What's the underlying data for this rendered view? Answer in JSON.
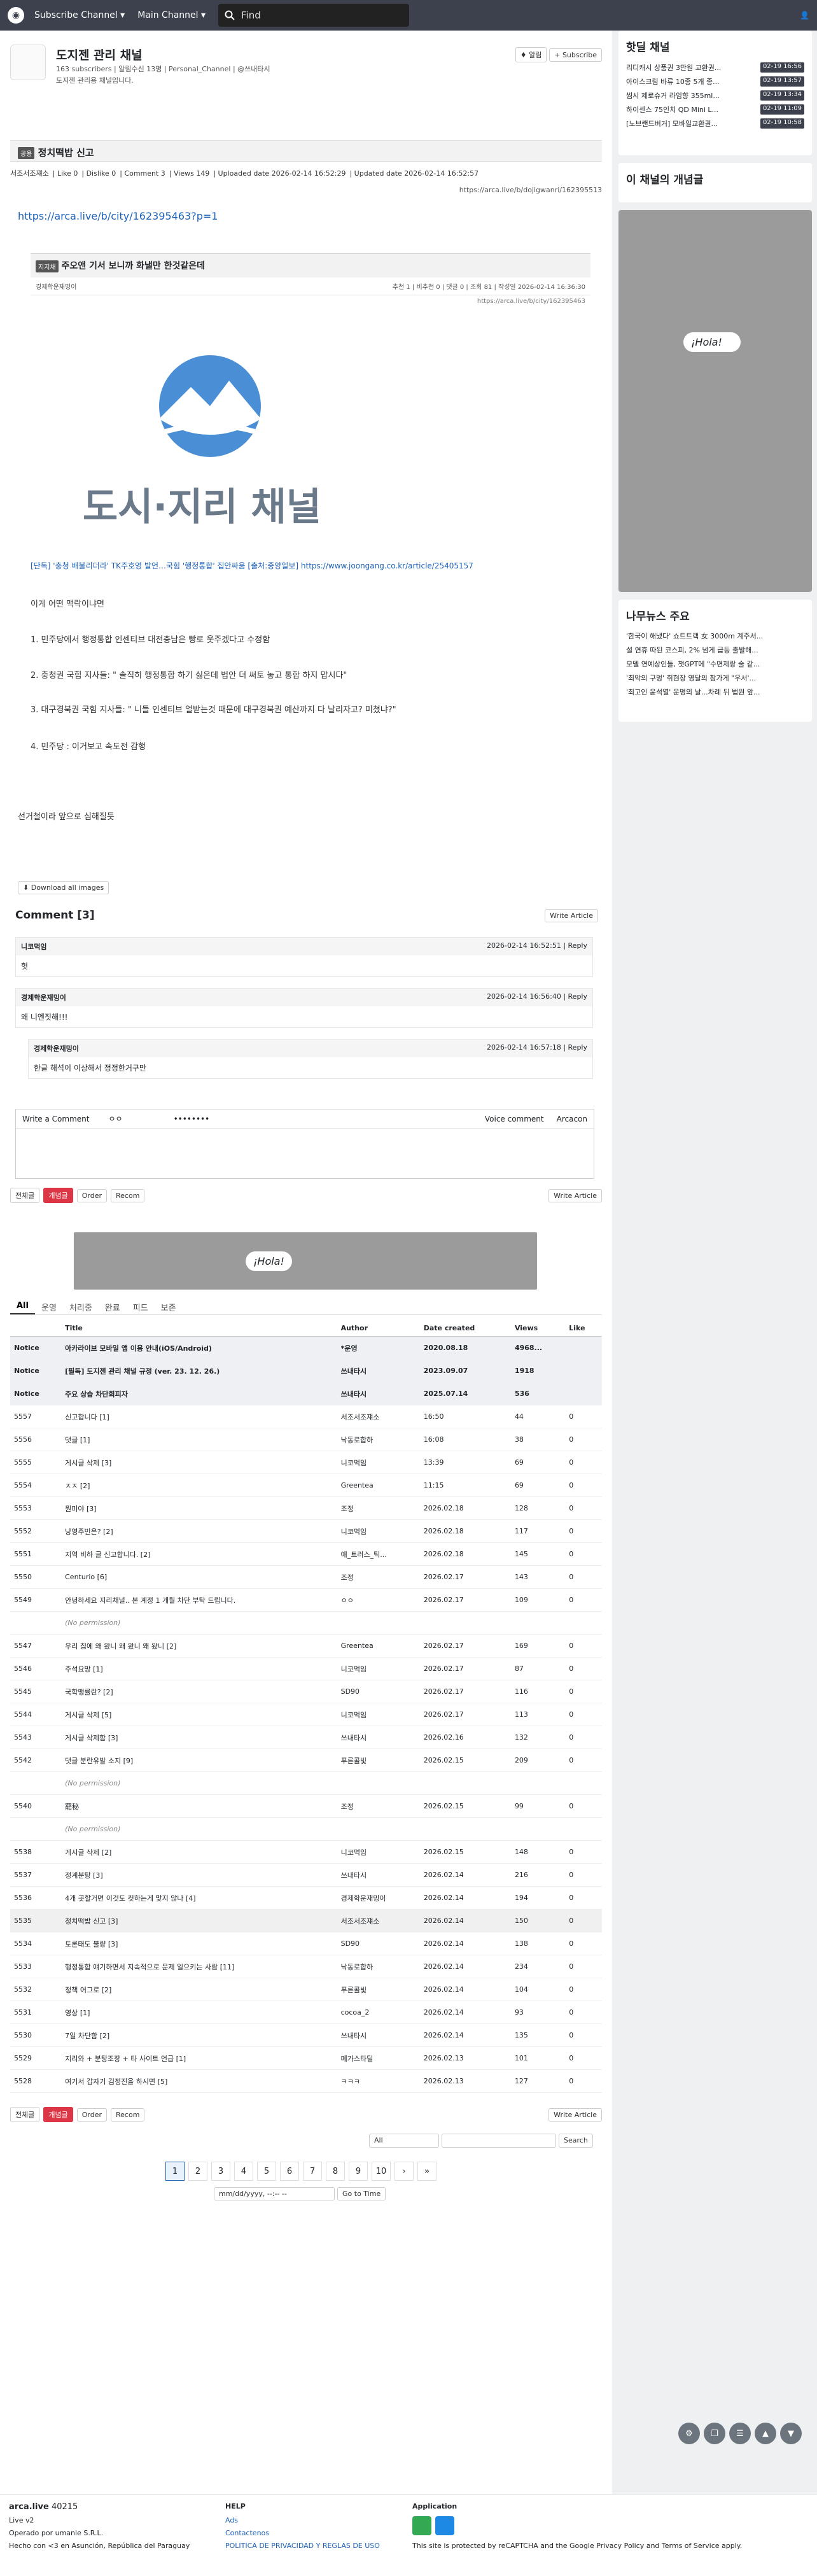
{
  "nav": {
    "subscribe": "Subscribe Channel ▾",
    "main": "Main Channel ▾",
    "search_placeholder": "Find"
  },
  "channel": {
    "title": "도지젠 관리 채널",
    "meta": "163 subscribers  |  알림수신 13명  |  Personal_Channel  |  @쓰내타시",
    "desc": "도지젠 관리용 채널입니다.",
    "alarm": "알림",
    "subscribe": "Subscribe"
  },
  "article": {
    "badge": "공용",
    "title": "정치떡밥 신고",
    "info": [
      "서조서조쟤소",
      "Like 0",
      "Dislike 0",
      "Comment 3",
      "Views 149",
      "Uploaded date 2026-02-14 16:52:29",
      "Updated date 2026-02-14 16:52:57"
    ],
    "url": "https://arca.live/b/dojigwanri/162395513",
    "link": "https://arca.live/b/city/162395463?p=1",
    "embed_badge": "지지채",
    "embed_title": "주오앤 기서 보니까 화낼만 한것같은데",
    "embed_author": "경제학운재밍이",
    "embed_stats": "추천 1 | 비추천 0 | 댓글 0 | 조회 81 | 작성일 2026-02-14 16:36:30",
    "embed_url": "https://arca.live/b/city/162395463",
    "logo_text": "도시·지리 채널",
    "news_link": "[단독] '충청 배불리더라' TK주호영 발언…국힘 '행정통합' 집안싸움 [출처:중앙일보] https://www.joongang.co.kr/article/25405157",
    "body": [
      "이게 어떤 맥락이냐면",
      "1. 민주당에서 행정통합 인센티브 대전충남은 빵로 웃주겠다고 수정함",
      "2. 충청권 국힘 지사들: \" 솔직히 행정통합 하기 싫은데 법안 더 써토 놓고 통합 하지 맙시다\"",
      "3. 대구경북권 국힘 지사들: \" 니들 인센티브 얼받는것 때문에 대구경북권 예산까지 다 날리자고? 미쳤냐?\"",
      "4. 민주당 : 이거보고 속도전 감행",
      "선거철이라 앞으로 심해질듯"
    ],
    "download": "Download all images"
  },
  "comments": {
    "title": "Comment [3]",
    "write": "Write Article",
    "list": [
      {
        "author": "니코먹임",
        "date": "2026-02-14 16:52:51",
        "text": "헛"
      },
      {
        "author": "경제학운재밍이",
        "date": "2026-02-14 16:56:40",
        "text": "왜 니엔짓해!!!"
      },
      {
        "author": "경제학운재밍이",
        "date": "2026-02-14 16:57:18",
        "text": "한글 해석이 이상해서 정정한거구만"
      }
    ],
    "reply": "Reply",
    "editor_label": "Write a Comment",
    "editor_name": "ㅇㅇ",
    "editor_pw": "••••••••",
    "voice": "Voice comment",
    "arcacon": "Arcacon"
  },
  "bar": {
    "all": "전체글",
    "best": "개념글",
    "order": "Order",
    "recom": "Recom",
    "write": "Write Article"
  },
  "banner_text": "¡Hola!",
  "tabs": [
    "All",
    "운영",
    "처리중",
    "완료",
    "피드",
    "보존"
  ],
  "table": {
    "headers": [
      "",
      "Title",
      "Author",
      "Date created",
      "Views",
      "Like"
    ],
    "rows": [
      [
        "Notice",
        "아카라이브 모바일 앱 이용 안내(iOS/Android)",
        "*운영",
        "2020.08.18",
        "4968...",
        ""
      ],
      [
        "Notice",
        "[필독] 도지젠 관리 채널 규정 (ver. 23. 12. 26.)",
        "쓰내타시",
        "2023.09.07",
        "1918",
        ""
      ],
      [
        "Notice",
        "주요 상습 차단회피자",
        "쓰내타시",
        "2025.07.14",
        "536",
        ""
      ],
      [
        "5557",
        "신고합니다 [1]",
        "서조서조쟤소",
        "16:50",
        "44",
        "0"
      ],
      [
        "5556",
        "댓글 [1]",
        "낙동로합하",
        "16:08",
        "38",
        "0"
      ],
      [
        "5555",
        "게시글 삭제 [3]",
        "니코먹임",
        "13:39",
        "69",
        "0"
      ],
      [
        "5554",
        "ㅈㅈ [2]",
        "Greentea",
        "11:15",
        "69",
        "0"
      ],
      [
        "5553",
        "뭔미야 [3]",
        "조정",
        "2026.02.18",
        "128",
        "0"
      ],
      [
        "5552",
        "낭영주빈은? [2]",
        "니코먹임",
        "2026.02.18",
        "117",
        "0"
      ],
      [
        "5551",
        "지역 비하 글 신고합니다. [2]",
        "애_트러스_틱...",
        "2026.02.18",
        "145",
        "0"
      ],
      [
        "5550",
        "Centurio [6]",
        "조정",
        "2026.02.17",
        "143",
        "0"
      ],
      [
        "5549",
        "안녕하세요 지리채널.. 본 계정 1 개월 차단 부탁 드립니다.",
        "ㅇㅇ",
        "2026.02.17",
        "109",
        "0"
      ],
      [
        "",
        "(No permission)",
        "",
        "",
        "",
        ""
      ],
      [
        "5547",
        "우리 집에 왜 왔니 왜 왔니 왜 왔니 [2]",
        "Greentea",
        "2026.02.17",
        "169",
        "0"
      ],
      [
        "5546",
        "주석요망 [1]",
        "니코먹임",
        "2026.02.17",
        "87",
        "0"
      ],
      [
        "5545",
        "국학맹률란? [2]",
        "SD90",
        "2026.02.17",
        "116",
        "0"
      ],
      [
        "5544",
        "게시글 삭제 [5]",
        "니코먹임",
        "2026.02.17",
        "113",
        "0"
      ],
      [
        "5543",
        "게시글 삭제함 [3]",
        "쓰내타시",
        "2026.02.16",
        "132",
        "0"
      ],
      [
        "5542",
        "댓글 분란유발 소지 [9]",
        "푸른콜빛",
        "2026.02.15",
        "209",
        "0"
      ],
      [
        "",
        "(No permission)",
        "",
        "",
        "",
        ""
      ],
      [
        "5540",
        "罷秘",
        "조정",
        "2026.02.15",
        "99",
        "0"
      ],
      [
        "",
        "(No permission)",
        "",
        "",
        "",
        ""
      ],
      [
        "5538",
        "게시글 삭제 [2]",
        "니코먹임",
        "2026.02.15",
        "148",
        "0"
      ],
      [
        "5537",
        "정계분탕 [3]",
        "쓰내타시",
        "2026.02.14",
        "216",
        "0"
      ],
      [
        "5536",
        "4개 곳할거면 이것도 컷하는게 맞지 않나 [4]",
        "경제학운재밍이",
        "2026.02.14",
        "194",
        "0"
      ],
      [
        "5535",
        "정치떡밥 신고 [3]",
        "서조서조쟤소",
        "2026.02.14",
        "150",
        "0"
      ],
      [
        "5534",
        "토론태도 불량 [3]",
        "SD90",
        "2026.02.14",
        "138",
        "0"
      ],
      [
        "5533",
        "행정통합 얘기하면서 지속적으로 문제 일으키는 사람 [11]",
        "낙동로합하",
        "2026.02.14",
        "234",
        "0"
      ],
      [
        "5532",
        "정책 어그로 [2]",
        "푸른콜빛",
        "2026.02.14",
        "104",
        "0"
      ],
      [
        "5531",
        "영상 [1]",
        "cocoa_2",
        "2026.02.14",
        "93",
        "0"
      ],
      [
        "5530",
        "7일 차단함 [2]",
        "쓰내타시",
        "2026.02.14",
        "135",
        "0"
      ],
      [
        "5529",
        "지리와 + 분탕조장 + 타 사이트 언급 [1]",
        "메가스타딜",
        "2026.02.13",
        "101",
        "0"
      ],
      [
        "5528",
        "여기서 갑자기 김정진을 하시면 [5]",
        "ㅋㅋㅋ",
        "2026.02.13",
        "127",
        "0"
      ]
    ]
  },
  "search": {
    "scope": "All",
    "button": "Search",
    "date_ph": "mm/dd/yyyy, --:-- --",
    "goto": "Go to Time"
  },
  "pages": [
    "1",
    "2",
    "3",
    "4",
    "5",
    "6",
    "7",
    "8",
    "9",
    "10",
    "›",
    "»"
  ],
  "side": {
    "hot_title": "핫딜 채널",
    "hot": [
      [
        "리디캐시 상품권 3만원 교환권...",
        "02-19 16:56"
      ],
      [
        "아이스크림 바류 10종 5개 종...",
        "02-19 13:57"
      ],
      [
        "썸시 제로슈거 라임향 355ml...",
        "02-19 13:34"
      ],
      [
        "하이센스 75인치 QD Mini L...",
        "02-19 11:09"
      ],
      [
        "[노브랜드버거] 모바일교환권...",
        "02-19 10:58"
      ]
    ],
    "concept_title": "이 채널의 개념글",
    "news_title": "나무뉴스 주요",
    "news": [
      "'한국이 해냈다' 쇼트트랙 女 3000m 계주서...",
      "설 연휴 따된 코스피, 2% 넘게 급등 출발해...",
      "모델 연예상인들, 챗GPT에 \"수면제랑 술 같...",
      "'최악의 구멍' 취현장 영달의 참가게 \"우서'...",
      "'최고인 윤석열' 운명의 날…차례 뒤 법원 앞..."
    ]
  },
  "footer": {
    "brand": "arca.live",
    "count": "40215",
    "ver": "Live v2",
    "op": "Operado por umanle S.R.L.",
    "made": "Hecho con <3 en Asunción, República del Paraguay",
    "help": "HELP",
    "links": [
      "Ads",
      "Contactenos",
      "POLITICA DE PRIVACIDAD Y REGLAS DE USO"
    ],
    "app": "Application",
    "legal": "This site is protected by reCAPTCHA and the Google Privacy Policy and Terms of Service apply."
  }
}
